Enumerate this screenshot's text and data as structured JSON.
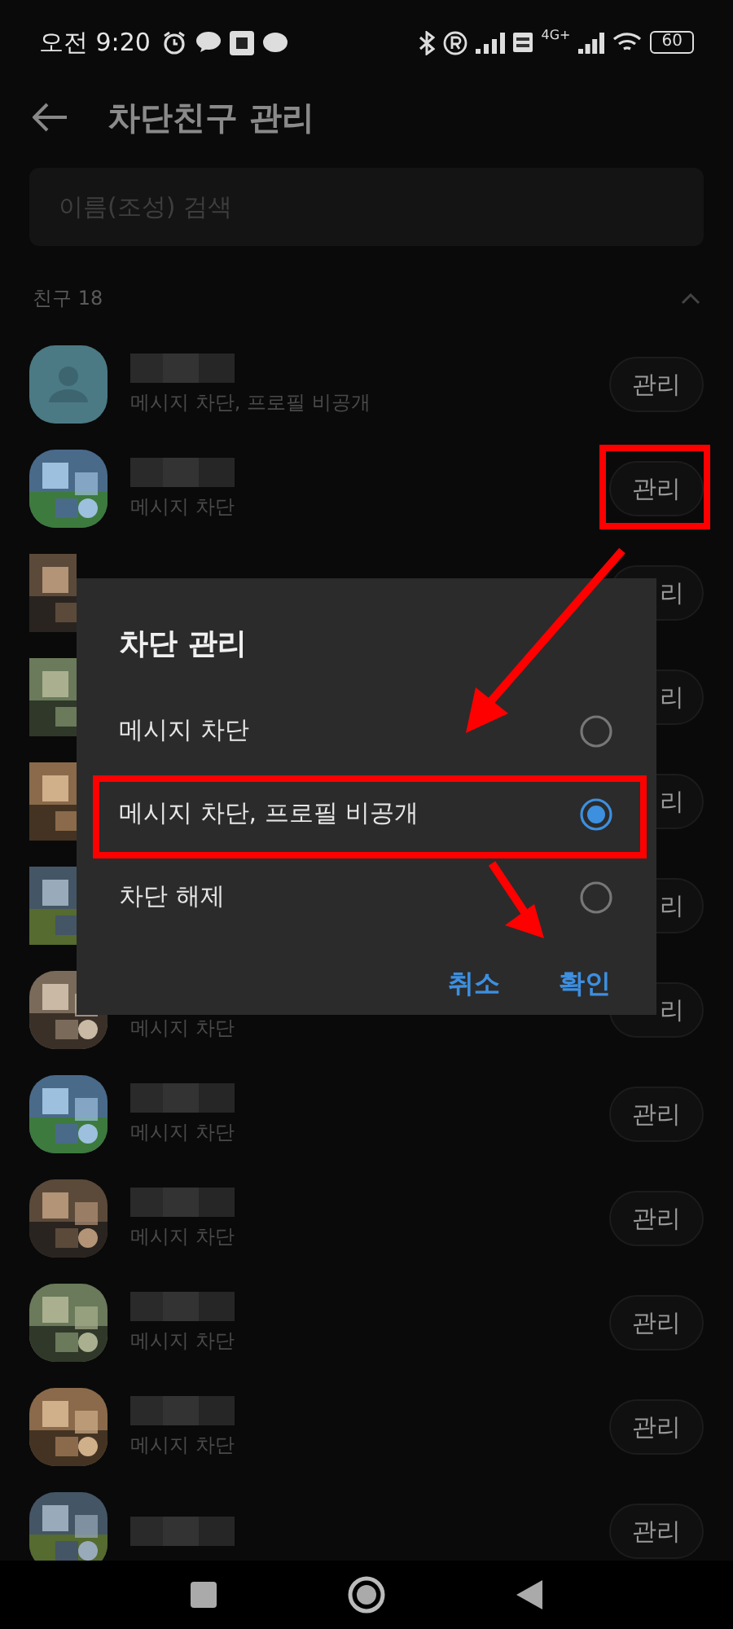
{
  "status_bar": {
    "time": "오전 9:20",
    "network": "4G+",
    "battery": "60"
  },
  "header": {
    "title": "차단친구 관리"
  },
  "search": {
    "placeholder": "이름(조성) 검색"
  },
  "section": {
    "label": "친구 18",
    "expanded": true
  },
  "friends": [
    {
      "kind": "default",
      "status": "메시지 차단, 프로필 비공개",
      "button": "관리",
      "highlighted": false
    },
    {
      "kind": "picture",
      "status": "메시지 차단",
      "button": "관리",
      "highlighted": true
    },
    {
      "kind": "covered",
      "button": "리",
      "highlighted": false
    },
    {
      "kind": "covered",
      "button": "리",
      "highlighted": false
    },
    {
      "kind": "covered",
      "button": "리",
      "highlighted": false
    },
    {
      "kind": "covered",
      "button": "리",
      "highlighted": false
    },
    {
      "kind": "edge",
      "status": "메시지 차단",
      "button": "리",
      "highlighted": false
    },
    {
      "kind": "picture",
      "status": "메시지 차단",
      "button": "관리",
      "highlighted": false
    },
    {
      "kind": "picture",
      "status": "메시지 차단",
      "button": "관리",
      "highlighted": false
    },
    {
      "kind": "picture",
      "status": "메시지 차단",
      "button": "관리",
      "highlighted": false
    },
    {
      "kind": "picture",
      "status": "메시지 차단",
      "button": "관리",
      "highlighted": false
    },
    {
      "kind": "picture",
      "button": "관리",
      "highlighted": false
    }
  ],
  "dialog": {
    "title": "차단 관리",
    "options": [
      {
        "label": "메시지 차단",
        "selected": false,
        "highlighted": false
      },
      {
        "label": "메시지 차단, 프로필 비공개",
        "selected": true,
        "highlighted": true
      },
      {
        "label": "차단 해제",
        "selected": false,
        "highlighted": false
      }
    ],
    "buttons": [
      "취소",
      "확인"
    ]
  }
}
